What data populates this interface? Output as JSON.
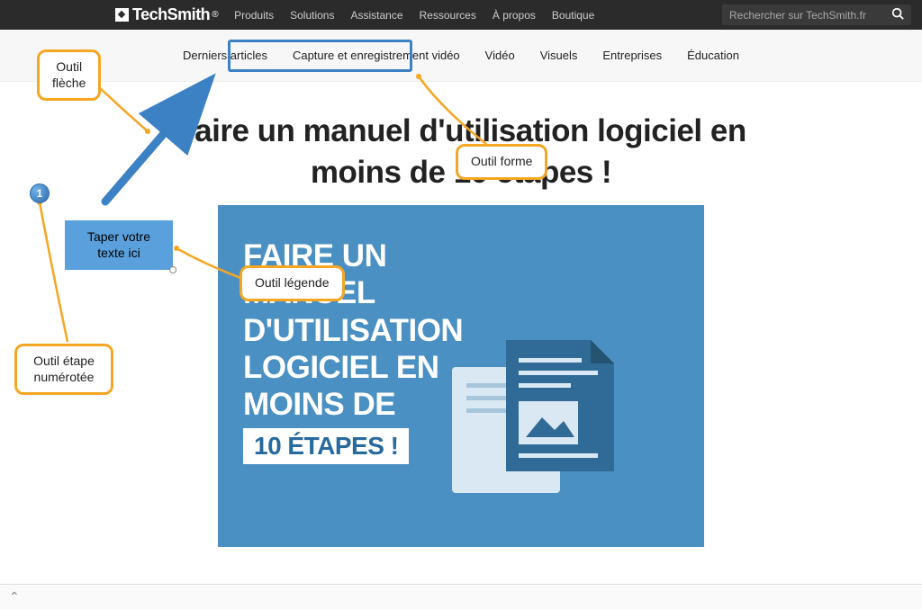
{
  "header": {
    "brand": "TechSmith",
    "brand_suffix": "®",
    "nav": [
      "Produits",
      "Solutions",
      "Assistance",
      "Ressources",
      "À propos",
      "Boutique"
    ],
    "search_placeholder": "Rechercher sur TechSmith.fr"
  },
  "subnav": [
    "Derniers articles",
    "Capture et enregistrement vidéo",
    "Vidéo",
    "Visuels",
    "Entreprises",
    "Éducation"
  ],
  "headline": "Faire un manuel d'utilisation logiciel en moins de 10 étapes !",
  "hero": {
    "line1": "FAIRE UN MANUEL D'UTILISATION LOGICIEL EN MOINS DE",
    "button": "10 ÉTAPES !"
  },
  "annotations": {
    "arrow_tool": "Outil flèche",
    "shape_tool": "Outil forme",
    "callout_tool": "Outil légende",
    "step_tool": "Outil étape numérotée",
    "text_placeholder": "Taper votre texte ici",
    "step_number": "1"
  },
  "colors": {
    "callout_border": "#f5a623",
    "highlight_border": "#3b81c4",
    "hero_bg": "#4a90c2"
  }
}
